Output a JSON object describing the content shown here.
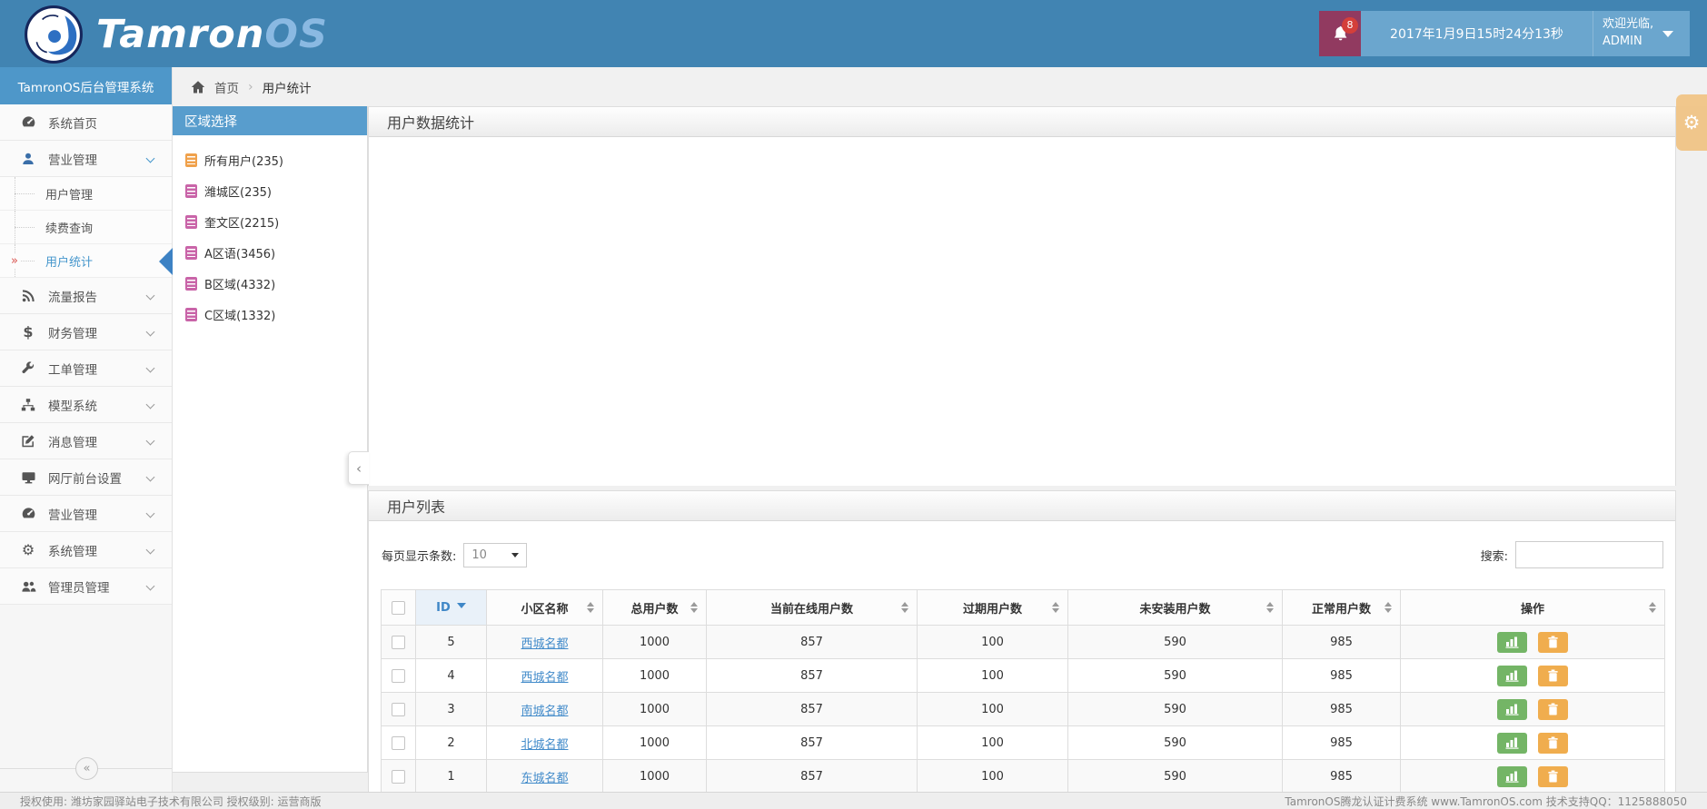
{
  "header": {
    "logo_primary": "Tamron",
    "logo_secondary": "OS",
    "notification_count": "8",
    "datetime": "2017年1月9日15时24分13秒",
    "welcome_line1": "欢迎光临,",
    "welcome_line2": "ADMIN"
  },
  "breadcrumb": {
    "home": "首页",
    "separator": "›",
    "current": "用户统计"
  },
  "sidebar": {
    "title": "TamronOS后台管理系统",
    "items": [
      {
        "label": "系统首页"
      },
      {
        "label": "营业管理"
      },
      {
        "label": "流量报告"
      },
      {
        "label": "财务管理"
      },
      {
        "label": "工单管理"
      },
      {
        "label": "模型系统"
      },
      {
        "label": "消息管理"
      },
      {
        "label": "网厅前台设置"
      },
      {
        "label": "营业管理"
      },
      {
        "label": "系统管理"
      },
      {
        "label": "管理员管理"
      }
    ],
    "submenu": [
      {
        "label": "用户管理"
      },
      {
        "label": "续费查询"
      },
      {
        "label": "用户统计",
        "active_marker": "»"
      }
    ],
    "collapse_glyph": "«"
  },
  "region": {
    "title": "区域选择",
    "items": [
      {
        "label": "所有用户(235)"
      },
      {
        "label": "潍城区(235)"
      },
      {
        "label": "奎文区(2215)"
      },
      {
        "label": "A区语(3456)"
      },
      {
        "label": "B区域(4332)"
      },
      {
        "label": "C区域(1332)"
      }
    ]
  },
  "main": {
    "stats_panel_title": "用户数据统计",
    "list_panel_title": "用户列表",
    "collapse_glyph": "‹",
    "pagesize_label": "每页显示条数:",
    "pagesize_value": "10",
    "search_label": "搜索:",
    "table": {
      "headers": [
        "ID",
        "小区名称",
        "总用户数",
        "当前在线用户数",
        "过期用户数",
        "未安装用户数",
        "正常用户数",
        "操作"
      ],
      "sorted_column": "ID",
      "sort_direction": "desc",
      "rows": [
        {
          "id": "5",
          "name": "西城名都",
          "total": "1000",
          "online": "857",
          "expired": "100",
          "uninstalled": "590",
          "normal": "985"
        },
        {
          "id": "4",
          "name": "西城名都",
          "total": "1000",
          "online": "857",
          "expired": "100",
          "uninstalled": "590",
          "normal": "985"
        },
        {
          "id": "3",
          "name": "南城名都",
          "total": "1000",
          "online": "857",
          "expired": "100",
          "uninstalled": "590",
          "normal": "985"
        },
        {
          "id": "2",
          "name": "北城名都",
          "total": "1000",
          "online": "857",
          "expired": "100",
          "uninstalled": "590",
          "normal": "985"
        },
        {
          "id": "1",
          "name": "东城名都",
          "total": "1000",
          "online": "857",
          "expired": "100",
          "uninstalled": "590",
          "normal": "985"
        }
      ]
    }
  },
  "footer": {
    "left": "授权使用: 潍坊家园驿站电子技术有限公司  授权级别: 运营商版",
    "right": "TamronOS腾龙认证计费系统 www.TamronOS.com 技术支持QQ：1125888050"
  },
  "colors": {
    "header_blue": "#4184b2",
    "panel_blue": "#589dcd",
    "box_blue": "#6ba6ce",
    "bell_maroon": "#913a60",
    "badge_red": "#d43f3a",
    "link_blue": "#428bca",
    "active_blue": "#4596cc",
    "button_green": "#74b566",
    "button_orange": "#f0ad4e",
    "region_icon_orange": "#f0a14b",
    "region_icon_pink": "#c964a8"
  }
}
